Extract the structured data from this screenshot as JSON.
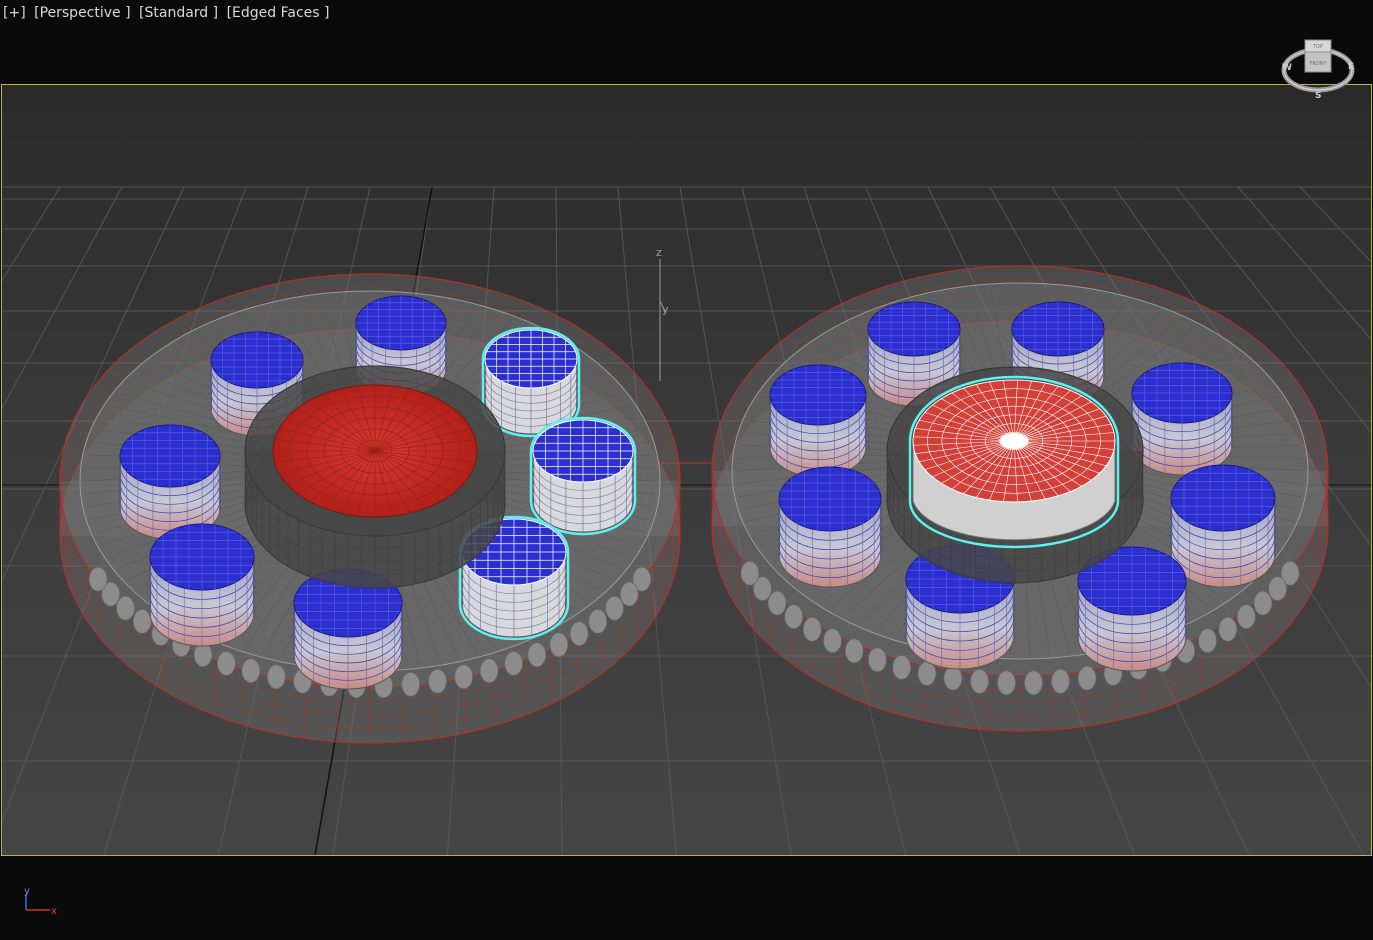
{
  "viewport": {
    "labels": {
      "menu": "[+]",
      "view": "[Perspective ]",
      "shading": "[Standard ]",
      "display_mode": "[Edged Faces ]"
    },
    "viewcube": {
      "face_top": "TOP",
      "face_front": "FRONT",
      "compass_w": "W",
      "compass_e": "E",
      "compass_s": "S"
    },
    "gizmo": {
      "z_label": "z",
      "y_label": "y"
    },
    "axis_tripod": {
      "y_label": "y",
      "x_label": "x"
    }
  },
  "colors": {
    "frame_border": "#b9b34a",
    "selection_highlight": "#5ff0f0",
    "cap_blue": "#2b2fd0",
    "core_red": "#cc2a22",
    "wire_gray": "#8a8a8a",
    "rim_red": "#b0302c"
  },
  "scene": {
    "selected_object_count": 4,
    "left_bearing_cylinder_count": 8,
    "right_bearing_cylinder_count": 8
  }
}
